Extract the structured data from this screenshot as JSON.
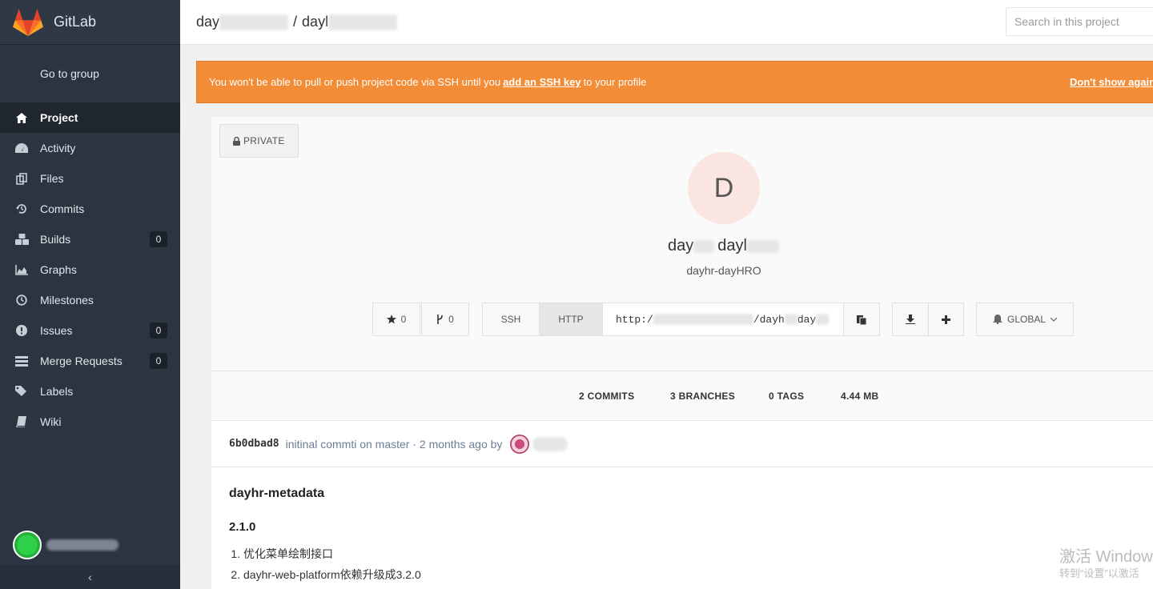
{
  "app": {
    "name": "GitLab"
  },
  "sidebar": {
    "go_to_group": "Go to group",
    "items": [
      {
        "label": "Project",
        "icon": "home-icon",
        "active": true
      },
      {
        "label": "Activity",
        "icon": "dashboard-icon"
      },
      {
        "label": "Files",
        "icon": "files-icon"
      },
      {
        "label": "Commits",
        "icon": "history-icon"
      },
      {
        "label": "Builds",
        "icon": "cubes-icon",
        "count": "0"
      },
      {
        "label": "Graphs",
        "icon": "area-chart-icon"
      },
      {
        "label": "Milestones",
        "icon": "clock-icon"
      },
      {
        "label": "Issues",
        "icon": "exclamation-circle-icon",
        "count": "0"
      },
      {
        "label": "Merge Requests",
        "icon": "list-icon",
        "count": "0"
      },
      {
        "label": "Labels",
        "icon": "tags-icon"
      },
      {
        "label": "Wiki",
        "icon": "book-icon"
      }
    ],
    "collapse_glyph": "‹"
  },
  "header": {
    "breadcrumb_group": "day",
    "breadcrumb_sep": "/",
    "breadcrumb_project": "dayl",
    "search_placeholder": "Search in this project"
  },
  "alert": {
    "text_before": "You won't be able to pull or push project code via SSH until you",
    "link": "add an SSH key",
    "text_after": "to your profile",
    "dismiss": "Don't show again"
  },
  "project": {
    "visibility": "PRIVATE",
    "avatar_letter": "D",
    "title_part1": "day",
    "title_part2": "dayl",
    "description": "dayhr-dayHRO",
    "star_count": "0",
    "fork_count": "0",
    "ssh_label": "SSH",
    "http_label": "HTTP",
    "clone_url_start": "http:/",
    "clone_url_mid": "/dayh",
    "clone_url_end": "day",
    "notification_level": "GLOBAL"
  },
  "stats": {
    "commits": "2 COMMITS",
    "branches": "3 BRANCHES",
    "tags": "0 TAGS",
    "size": "4.44 MB"
  },
  "last_commit": {
    "sha": "6b0dbad8",
    "message": "initinal commti on master · 2 months ago by"
  },
  "readme": {
    "title": "dayhr-metadata",
    "version": "2.1.0",
    "items": [
      "优化菜单绘制接口",
      "dayhr-web-platform依赖升级成3.2.0"
    ]
  },
  "watermark": {
    "line1": "激活 Windows",
    "line2": "转到“设置”以激活"
  },
  "colors": {
    "sidebar_bg": "#2b3440",
    "alert_bg": "#f38c36",
    "avatar_bg": "#fbe5e1",
    "brand_orange": "#e24329"
  }
}
